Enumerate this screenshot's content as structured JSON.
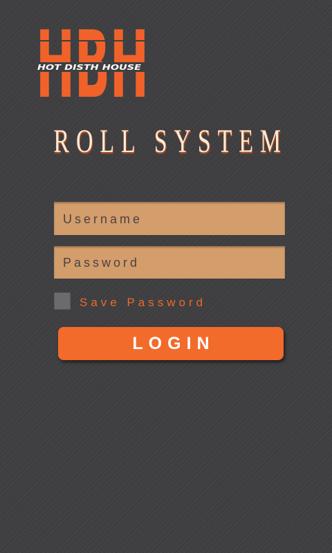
{
  "theme": {
    "background": "#3e3e40",
    "accent": "#f26b2b",
    "field": "#d49d6c",
    "title": "#f4ecdc",
    "label": "#ea6a2c",
    "checkbox": "#6b6b6d"
  },
  "logo": {
    "letters": "HBH",
    "tagline": "HOT DISTH HOUSE"
  },
  "title": "ROLL SYSTEM",
  "form": {
    "username": {
      "placeholder": "Username",
      "value": ""
    },
    "password": {
      "placeholder": "Password",
      "value": ""
    },
    "save_password": {
      "label": "Save Password",
      "checked": false
    },
    "login_button": {
      "label": "LOGIN"
    }
  }
}
